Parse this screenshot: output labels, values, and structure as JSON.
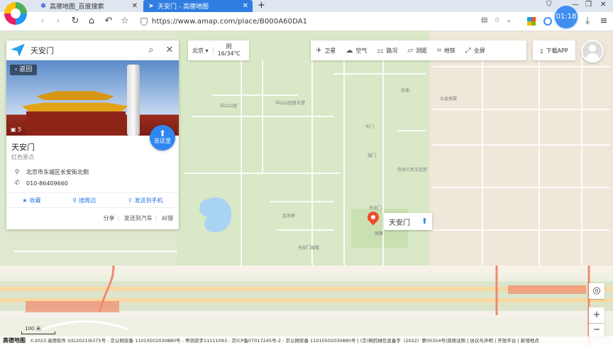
{
  "browser": {
    "tabs": [
      {
        "title": "高德地图_百度搜索",
        "active": false
      },
      {
        "title": "天安门 - 高德地图",
        "active": true
      }
    ],
    "url": "https://www.amap.com/place/B000A60DA1",
    "clock": "01:18"
  },
  "search": {
    "query": "天安门"
  },
  "place": {
    "back_label": "返回",
    "photo_count": "5",
    "goto_label": "去这里",
    "name": "天安门",
    "category": "红色景点",
    "address": "北京市东城区长安街北侧",
    "phone": "010-86409660",
    "actions": [
      "收藏",
      "搜周边",
      "发送到手机"
    ],
    "footer_links": [
      "分享",
      "发送到汽车",
      "纠错"
    ]
  },
  "city": {
    "name": "北京",
    "weather": "阴",
    "temperature": "16/34℃"
  },
  "toolbar": {
    "items": [
      {
        "label": "卫星",
        "icon": "satellite-icon"
      },
      {
        "label": "空气",
        "icon": "air-icon"
      },
      {
        "label": "路况",
        "icon": "traffic-icon"
      },
      {
        "label": "测距",
        "icon": "ruler-icon"
      },
      {
        "label": "地铁",
        "icon": "subway-icon"
      },
      {
        "label": "全屏",
        "icon": "fullscreen-icon"
      }
    ],
    "download": "下载APP"
  },
  "marker": {
    "label": "天安门"
  },
  "map": {
    "scale": "100 米",
    "poi_labels": [
      "中山公园音乐堂",
      "中山公园",
      "太庙",
      "劳动人民文化宫",
      "天安门",
      "午门",
      "端门",
      "天安门城楼",
      "国旗",
      "北京站",
      "太庙享殿",
      "中山公园",
      "金水桥"
    ]
  },
  "footer": {
    "brand": "高德地图",
    "text": "©2023 高德软件 GS(2021)6375号 - 京公网安备 11010502030880号 - 甲测资字11111093 - 京ICP备07017245号-2 - 京公网安备 11010502030880号 | (京)网药械信息备字（2022）第00354号|资质证照 | 协议与声明 | 开放平台 | 新增地点"
  },
  "colors": {
    "accent": "#2f86f0",
    "marker": "#f14b2e",
    "tab_active": "#2f7de1"
  }
}
